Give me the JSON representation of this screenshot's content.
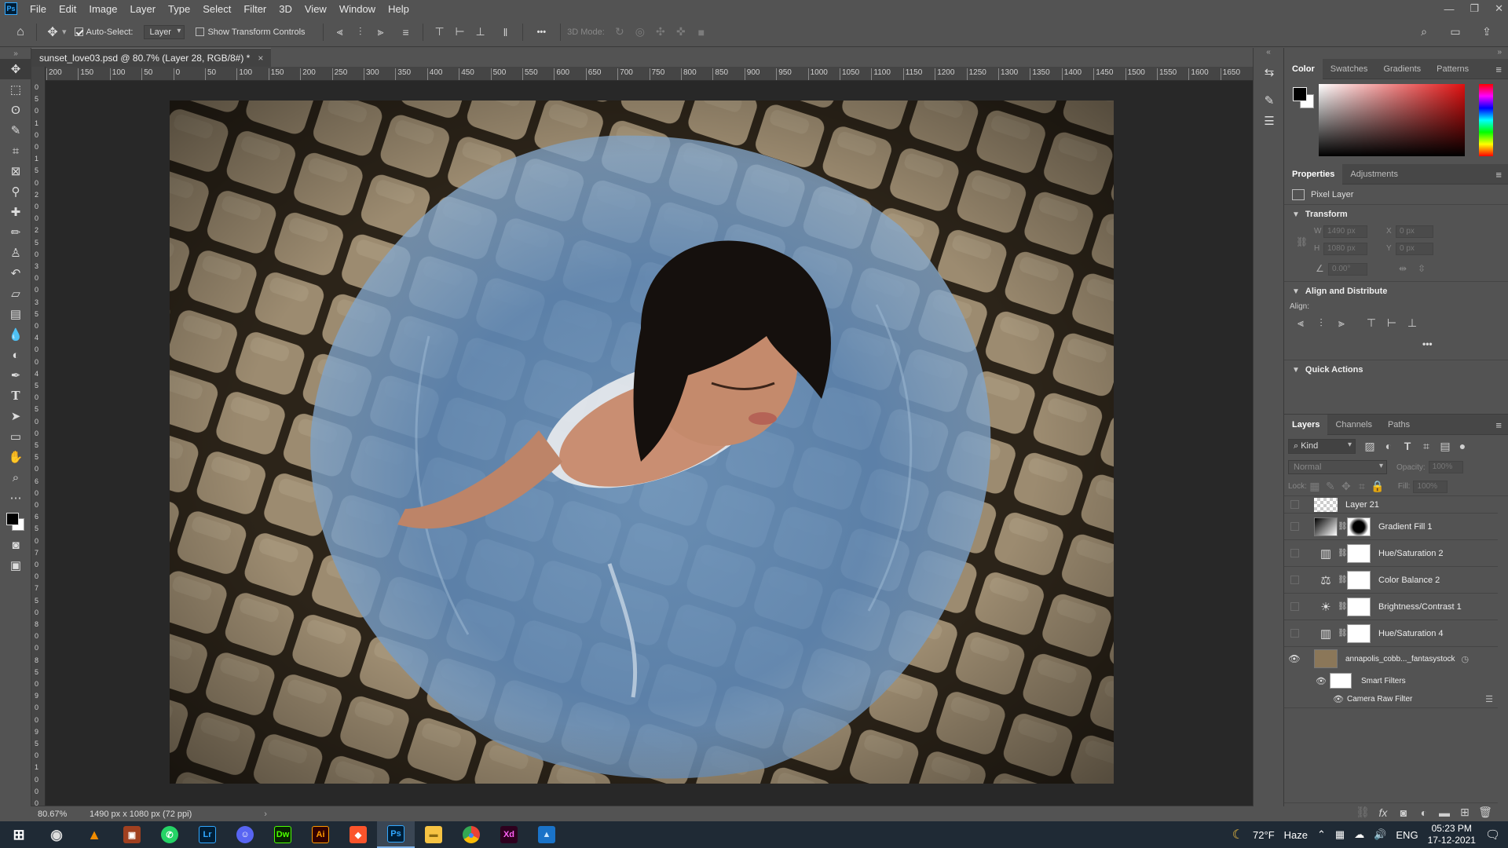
{
  "app": {
    "logo_text": "Ps"
  },
  "menu": [
    "File",
    "Edit",
    "Image",
    "Layer",
    "Type",
    "Select",
    "Filter",
    "3D",
    "View",
    "Window",
    "Help"
  ],
  "window_controls": {
    "minimize": "—",
    "restore": "❐",
    "close": "✕"
  },
  "options_bar": {
    "auto_select_label": "Auto-Select:",
    "auto_select_target": "Layer",
    "show_transform_label": "Show Transform Controls",
    "more": "•••",
    "mode_3d_label": "3D Mode:"
  },
  "document_tab": {
    "title": "sunset_love03.psd @ 80.7% (Layer 28, RGB/8#) *",
    "close": "×"
  },
  "ruler_h_labels": [
    "200",
    "150",
    "100",
    "50",
    "0",
    "50",
    "100",
    "150",
    "200",
    "250",
    "300",
    "350",
    "400",
    "450",
    "500",
    "550",
    "600",
    "650",
    "700",
    "750",
    "800",
    "850",
    "900",
    "950",
    "1000",
    "1050",
    "1100",
    "1150",
    "1200",
    "1250",
    "1300",
    "1350",
    "1400",
    "1450",
    "1500",
    "1550",
    "1600",
    "1650"
  ],
  "ruler_v_labels": [
    "0",
    "5",
    "0",
    "1",
    "0",
    "0",
    "1",
    "5",
    "0",
    "2",
    "0",
    "0",
    "2",
    "5",
    "0",
    "3",
    "0",
    "0",
    "3",
    "5",
    "0",
    "4",
    "0",
    "0",
    "4",
    "5",
    "0",
    "5",
    "0",
    "0",
    "5",
    "5",
    "0",
    "6",
    "0",
    "0",
    "6",
    "5",
    "0",
    "7",
    "0",
    "0",
    "7",
    "5",
    "0",
    "8",
    "0",
    "0",
    "8",
    "5",
    "0",
    "9",
    "0",
    "0",
    "9",
    "5",
    "0",
    "1",
    "0",
    "0",
    "0"
  ],
  "status": {
    "zoom": "80.67%",
    "doc_info": "1490 px x 1080 px (72 ppi)",
    "arrow": "›"
  },
  "color_panel": {
    "tabs": [
      "Color",
      "Swatches",
      "Gradients",
      "Patterns"
    ],
    "active": "Color",
    "fg": "#000000",
    "bg": "#ffffff",
    "hue": "#ff0000"
  },
  "properties_panel": {
    "tabs": [
      "Properties",
      "Adjustments"
    ],
    "layer_type": "Pixel Layer",
    "transform_title": "Transform",
    "w_label": "W",
    "w_value": "1490 px",
    "h_label": "H",
    "h_value": "1080 px",
    "x_label": "X",
    "x_value": "0 px",
    "y_label": "Y",
    "y_value": "0 px",
    "angle_value": "0.00°",
    "align_title": "Align and Distribute",
    "align_label": "Align:",
    "more": "•••",
    "quick_actions_title": "Quick Actions"
  },
  "layers_panel": {
    "tabs": [
      "Layers",
      "Channels",
      "Paths"
    ],
    "filter_kind": "Kind",
    "blend_mode": "Normal",
    "opacity_label": "Opacity:",
    "opacity_value": "100%",
    "lock_label": "Lock:",
    "fill_label": "Fill:",
    "fill_value": "100%",
    "layers": [
      {
        "name": "Layer 21",
        "kind": "pixel",
        "visible": false
      },
      {
        "name": "Gradient Fill 1",
        "kind": "gradient",
        "visible": false
      },
      {
        "name": "Hue/Saturation 2",
        "kind": "huesat",
        "visible": false
      },
      {
        "name": "Color Balance 2",
        "kind": "colorbalance",
        "visible": false
      },
      {
        "name": "Brightness/Contrast 1",
        "kind": "brightness",
        "visible": false
      },
      {
        "name": "Hue/Saturation 4",
        "kind": "huesat",
        "visible": false
      },
      {
        "name": "annapolis_cobb..._fantasystock",
        "kind": "smart",
        "visible": true
      },
      {
        "name": "Smart Filters",
        "kind": "smartfilters",
        "visible": true
      },
      {
        "name": "Camera Raw Filter",
        "kind": "filter",
        "visible": true
      }
    ]
  },
  "taskbar": {
    "apps": [
      {
        "name": "start",
        "label": "⊞"
      },
      {
        "name": "obs",
        "label": "◉"
      },
      {
        "name": "vlc",
        "label": "▲"
      },
      {
        "name": "media",
        "label": "▣"
      },
      {
        "name": "whatsapp",
        "label": "✆"
      },
      {
        "name": "lightroom",
        "label": "Lr"
      },
      {
        "name": "discord",
        "label": "☺"
      },
      {
        "name": "dreamweaver",
        "label": "Dw"
      },
      {
        "name": "illustrator",
        "label": "Ai"
      },
      {
        "name": "brave",
        "label": "◆"
      },
      {
        "name": "photoshop",
        "label": "Ps"
      },
      {
        "name": "explorer",
        "label": "▬"
      },
      {
        "name": "chrome",
        "label": "●"
      },
      {
        "name": "xd",
        "label": "Xd"
      },
      {
        "name": "photos",
        "label": "▲"
      }
    ],
    "weather_temp": "72°F",
    "weather_desc": "Haze",
    "language": "ENG",
    "time": "05:23 PM",
    "date": "17-12-2021"
  }
}
